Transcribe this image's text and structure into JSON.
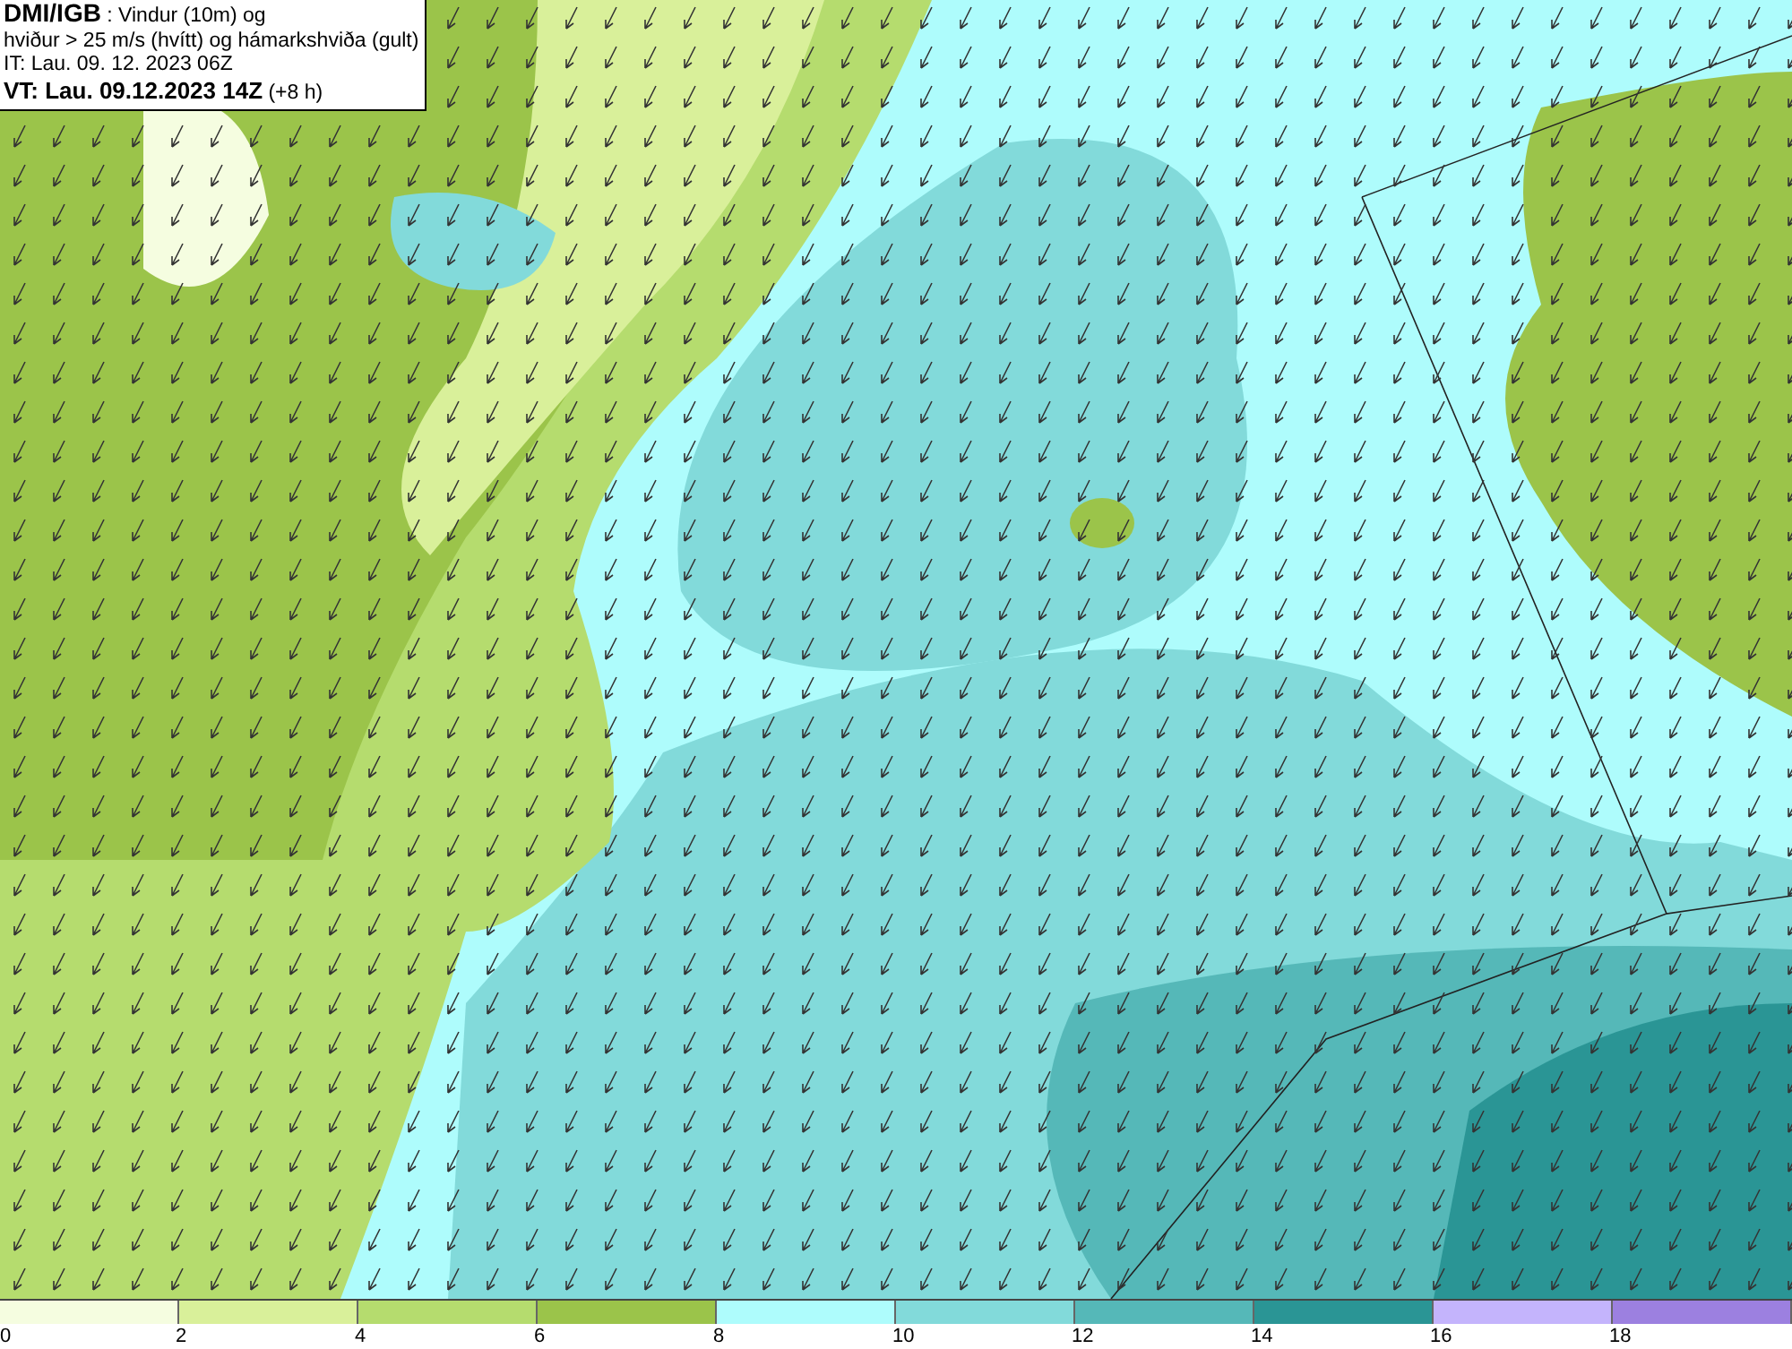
{
  "info_box": {
    "lines": [
      "**DMI/IGB** : Vindur (10m) og",
      "hviður > 25 m/s (hvítt) og hámarkshviða (gult)",
      "IT: Lau. 09. 12. 2023 06Z",
      "**VT: Lau. 09.12.2023 14Z** (+8 h)"
    ]
  },
  "legend": [
    {
      "label": "0",
      "color": "#f5fde0"
    },
    {
      "label": "2",
      "color": "#d9f09a"
    },
    {
      "label": "4",
      "color": "#b5dc6e"
    },
    {
      "label": "6",
      "color": "#9bc44a"
    },
    {
      "label": "8",
      "color": "#aefcfc"
    },
    {
      "label": "10",
      "color": "#82dada"
    },
    {
      "label": "12",
      "color": "#55b8b8"
    },
    {
      "label": "14",
      "color": "#2a9595"
    },
    {
      "label": "16",
      "color": "#c4b4fc"
    },
    {
      "label": "18",
      "color": "#9c80e0"
    }
  ]
}
